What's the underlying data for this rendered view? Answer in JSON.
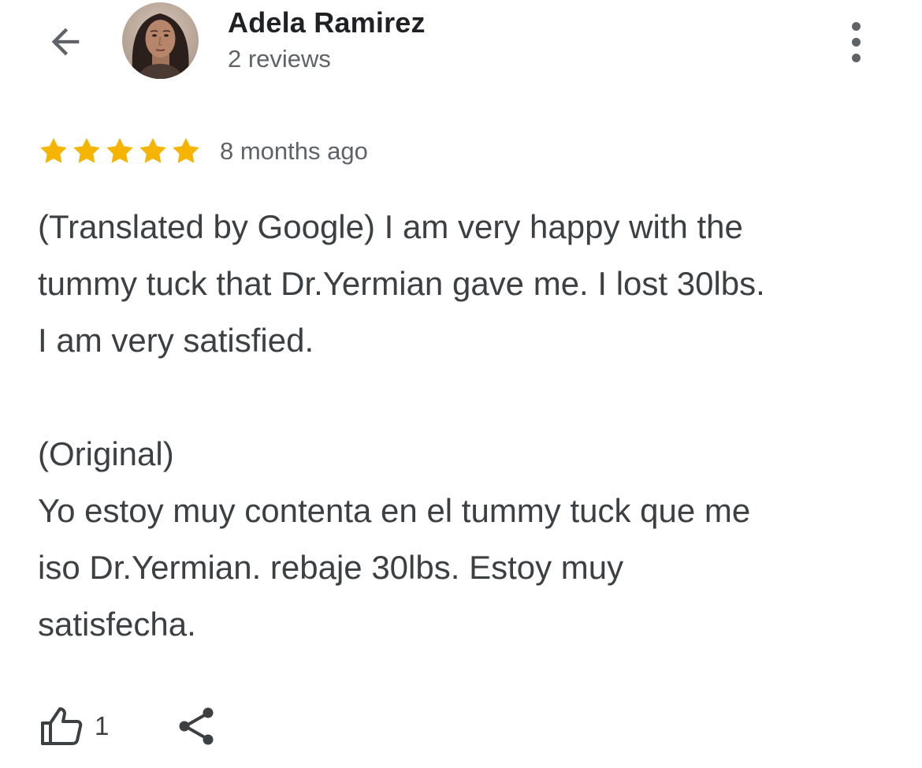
{
  "header": {
    "user_name": "Adela Ramirez",
    "reviews_count": "2 reviews",
    "icons": {
      "back": "arrow-left-icon",
      "more": "more-vertical-icon"
    }
  },
  "review": {
    "rating": 5,
    "rating_max": 5,
    "date": "8 months ago",
    "lines": [
      "(Translated by Google) I am very happy with the",
      "tummy tuck that Dr.Yermian gave me. I lost 30lbs.",
      "I am very satisfied.",
      "",
      "(Original)",
      "Yo estoy muy contenta en el tummy tuck que me",
      "iso Dr.Yermian. rebaje 30lbs. Estoy muy",
      "satisfecha."
    ]
  },
  "actions": {
    "like_count": "1",
    "icons": {
      "like": "thumbs-up-icon",
      "share": "share-icon"
    }
  },
  "colors": {
    "star": "#f4b400",
    "text_primary": "#202124",
    "text_body": "#3c4043",
    "text_secondary": "#5f6368",
    "icon": "#5f6368"
  }
}
